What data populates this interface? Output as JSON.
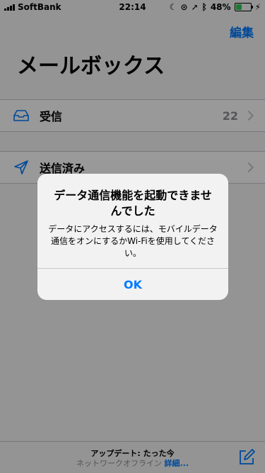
{
  "status_bar": {
    "carrier": "SoftBank",
    "time": "22:14",
    "battery": "48%",
    "battery_level": 0.48
  },
  "nav": {
    "edit_label": "編集"
  },
  "page": {
    "title": "メールボックス"
  },
  "mailboxes": [
    {
      "label": "受信",
      "count": "22",
      "icon": "inbox-tray-icon"
    },
    {
      "label": "送信済み",
      "count": "",
      "icon": "paper-plane-icon"
    }
  ],
  "toolbar": {
    "update_text": "アップデート: たった今",
    "offline_text": "ネットワークオフライン",
    "details_label": "詳細..."
  },
  "alert": {
    "title": "データ通信機能を起動できませんでした",
    "message": "データにアクセスするには、モバイルデータ通信をオンにするかWi-Fiを使用してください。",
    "ok_label": "OK"
  },
  "colors": {
    "accent": "#007aff",
    "battery_green": "#34c759"
  }
}
